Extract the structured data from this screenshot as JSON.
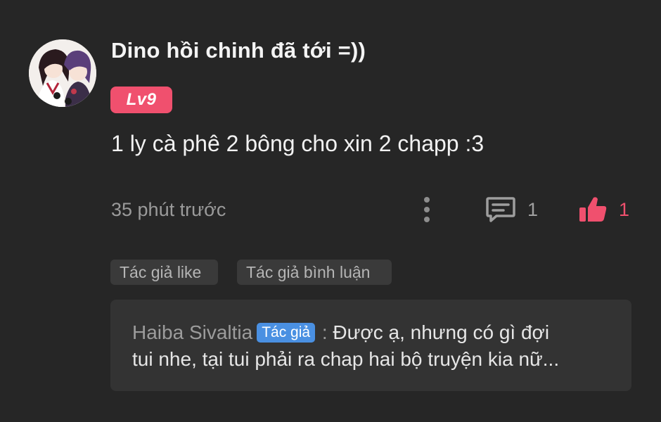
{
  "comment": {
    "username": "Dino hồi chinh đã tới =))",
    "level": "Lv9",
    "text": "1 ly cà phê 2 bông cho xin 2 chapp :3",
    "timestamp": "35 phút trước",
    "reply_count": "1",
    "like_count": "1",
    "liked": true
  },
  "tags": [
    "Tác giả like",
    "Tác giả bình luận"
  ],
  "reply_preview": {
    "author": "Haiba Sivaltia",
    "badge": "Tác giả",
    "separator": ":",
    "line1": "Được ạ, nhưng có gì đợi",
    "line2": "tui nhe, tại tui phải ra chap hai bộ truyện kia nữ..."
  },
  "colors": {
    "background": "#262626",
    "accent_pink": "#f0506e",
    "author_badge_blue": "#4a90e2",
    "tag_bg": "#3a3a3a",
    "reply_box_bg": "#333333"
  },
  "icons": {
    "more": "vertical-dots-icon",
    "reply": "chat-bubble-icon",
    "like": "thumbs-up-icon"
  }
}
